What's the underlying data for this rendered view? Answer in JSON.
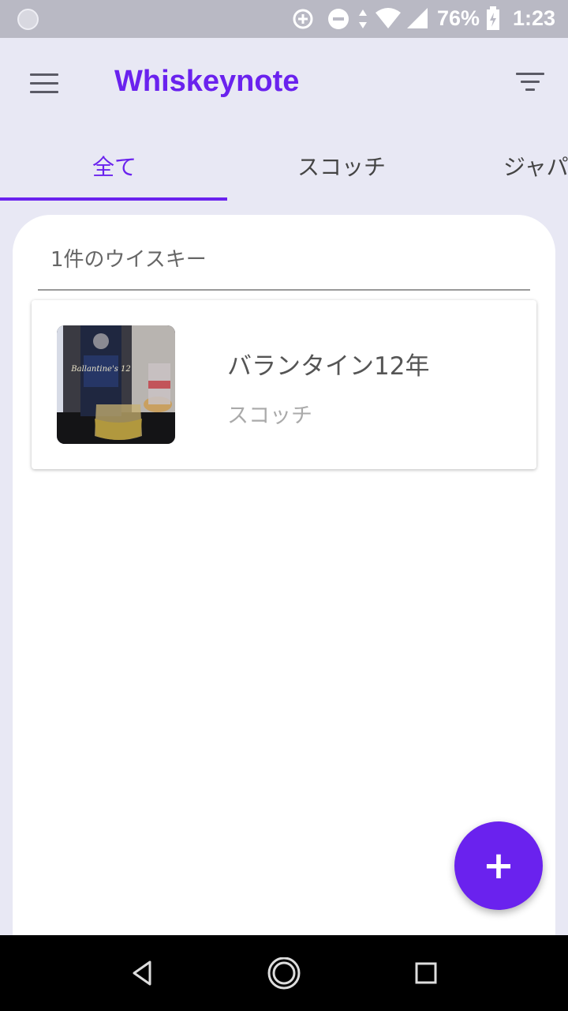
{
  "status_bar": {
    "battery": "76%",
    "time": "1:23",
    "icons": [
      "notification-dot-icon",
      "data-saver-icon",
      "do-not-disturb-icon",
      "data-arrows-icon",
      "wifi-icon",
      "signal-icon",
      "battery-charging-icon"
    ]
  },
  "app_bar": {
    "title": "Whiskeynote",
    "menu_icon": "menu-icon",
    "filter_icon": "filter-icon"
  },
  "tabs": [
    {
      "label": "全て",
      "active": true
    },
    {
      "label": "スコッチ",
      "active": false
    },
    {
      "label": "ジャパ",
      "active": false
    }
  ],
  "list": {
    "count_label": "1件のウイスキー",
    "items": [
      {
        "name": "バランタイン12年",
        "category": "スコッチ",
        "photo_text": "Ballantine's 12"
      }
    ]
  },
  "fab": {
    "label": "+"
  },
  "nav_bar": {
    "buttons": [
      "back-icon",
      "home-icon",
      "recents-icon"
    ]
  },
  "colors": {
    "accent": "#6a22ee",
    "background": "#e8e8f4",
    "status_bar": "#b9b9c4",
    "nav_bar": "#000000"
  }
}
